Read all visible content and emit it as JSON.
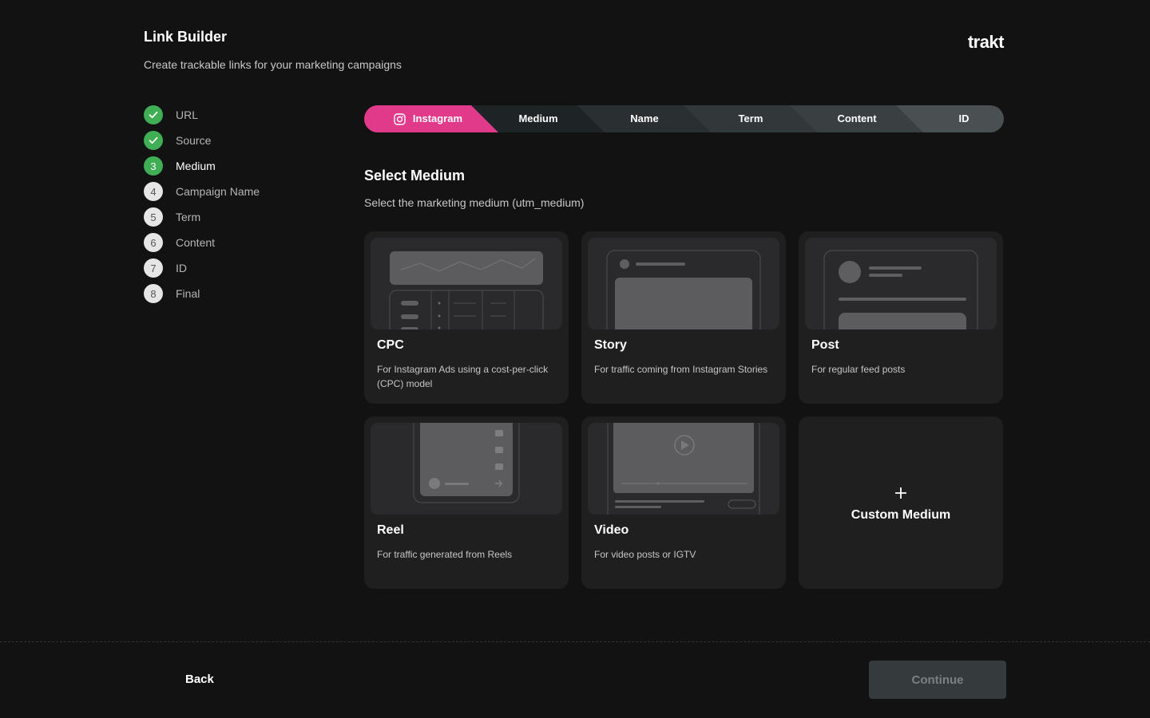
{
  "header": {
    "title": "Link Builder",
    "subtitle": "Create trackable links for your marketing campaigns",
    "logo": "trakt"
  },
  "steps": [
    {
      "num": "1",
      "label": "URL",
      "state": "done"
    },
    {
      "num": "2",
      "label": "Source",
      "state": "done"
    },
    {
      "num": "3",
      "label": "Medium",
      "state": "active"
    },
    {
      "num": "4",
      "label": "Campaign Name",
      "state": "pending"
    },
    {
      "num": "5",
      "label": "Term",
      "state": "pending"
    },
    {
      "num": "6",
      "label": "Content",
      "state": "pending"
    },
    {
      "num": "7",
      "label": "ID",
      "state": "pending"
    },
    {
      "num": "8",
      "label": "Final",
      "state": "pending"
    }
  ],
  "breadcrumb": {
    "items": [
      "Instagram",
      "Medium",
      "Name",
      "Term",
      "Content",
      "ID"
    ],
    "colors": [
      "#e23a8b",
      "#1e2326",
      "#2a2f32",
      "#323739",
      "#3a3f42",
      "#4a4f52"
    ]
  },
  "section": {
    "title": "Select Medium",
    "subtitle": "Select the marketing medium (utm_medium)"
  },
  "mediums": [
    {
      "name": "CPC",
      "desc": "For Instagram Ads using a cost-per-click (CPC) model"
    },
    {
      "name": "Story",
      "desc": "For traffic coming from Instagram Stories"
    },
    {
      "name": "Post",
      "desc": "For regular feed posts"
    },
    {
      "name": "Reel",
      "desc": "For traffic generated from Reels"
    },
    {
      "name": "Video",
      "desc": "For video posts or IGTV"
    }
  ],
  "custom": {
    "icon": "plus-icon",
    "label": "Custom Medium"
  },
  "footer": {
    "back": "Back",
    "continue": "Continue"
  },
  "colors": {
    "accent": "#e23a8b",
    "success": "#3fae54",
    "bg": "#121212",
    "card": "#1f1f1f"
  }
}
